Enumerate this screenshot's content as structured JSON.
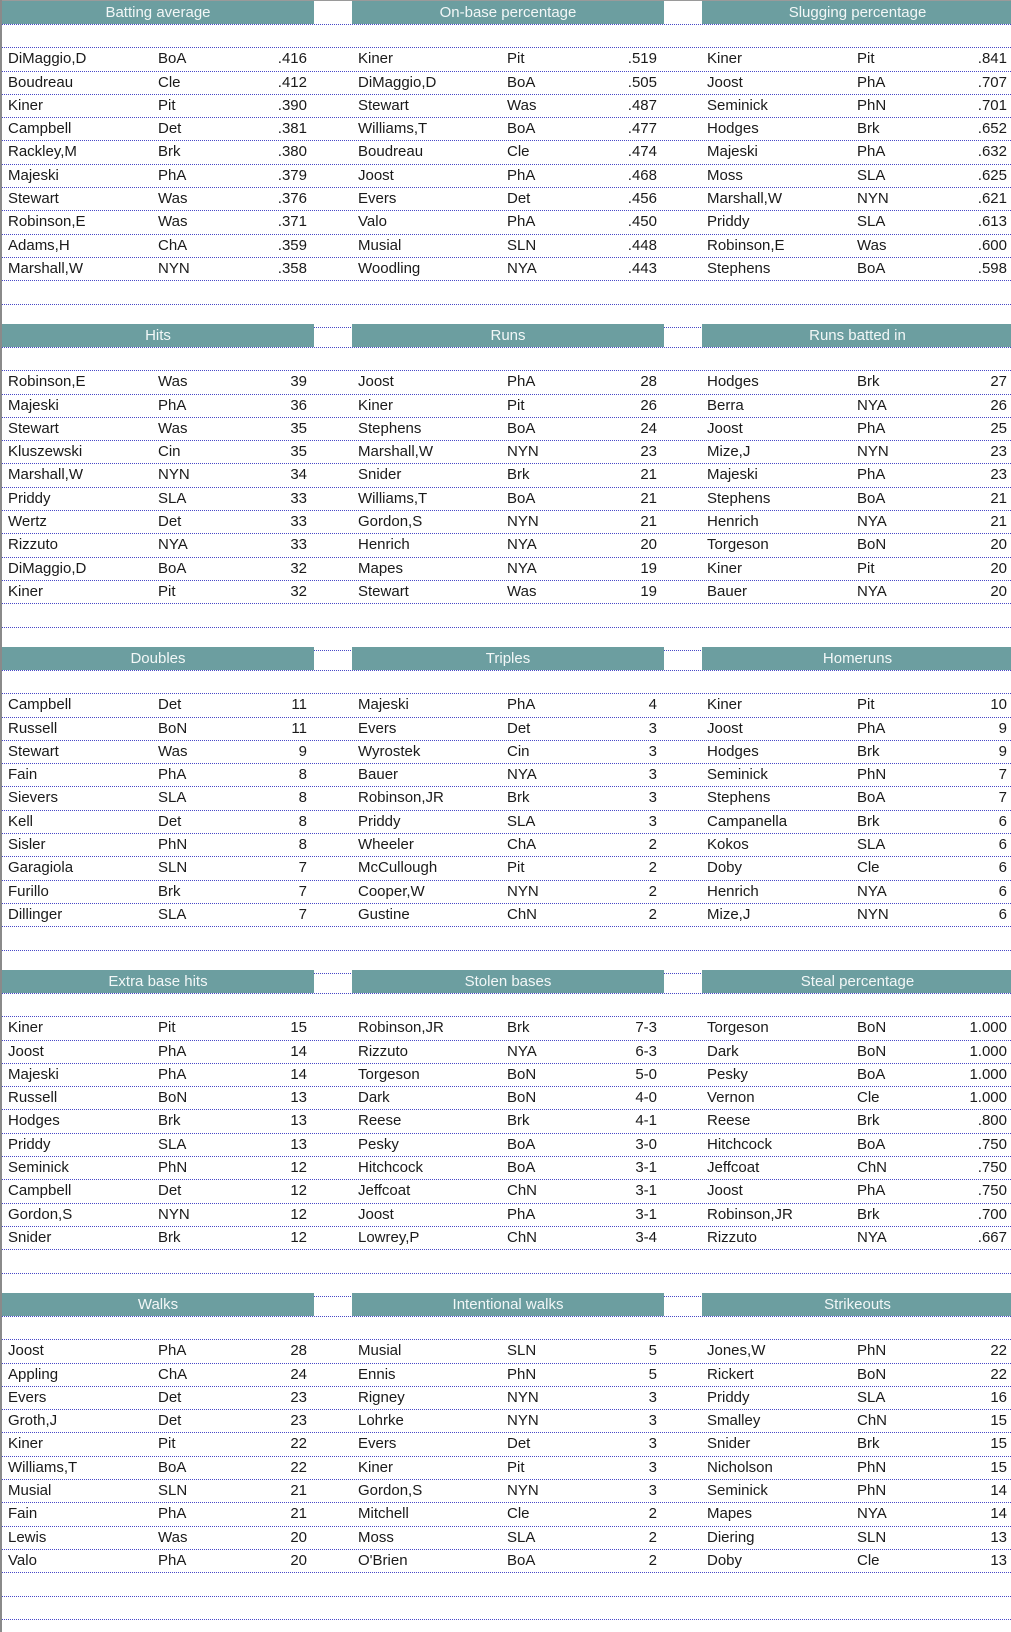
{
  "sections": [
    {
      "categories": [
        {
          "title": "Batting average",
          "rows": [
            [
              "DiMaggio,D",
              "BoA",
              ".416"
            ],
            [
              "Boudreau",
              "Cle",
              ".412"
            ],
            [
              "Kiner",
              "Pit",
              ".390"
            ],
            [
              "Campbell",
              "Det",
              ".381"
            ],
            [
              "Rackley,M",
              "Brk",
              ".380"
            ],
            [
              "Majeski",
              "PhA",
              ".379"
            ],
            [
              "Stewart",
              "Was",
              ".376"
            ],
            [
              "Robinson,E",
              "Was",
              ".371"
            ],
            [
              "Adams,H",
              "ChA",
              ".359"
            ],
            [
              "Marshall,W",
              "NYN",
              ".358"
            ]
          ]
        },
        {
          "title": "On-base percentage",
          "rows": [
            [
              "Kiner",
              "Pit",
              ".519"
            ],
            [
              "DiMaggio,D",
              "BoA",
              ".505"
            ],
            [
              "Stewart",
              "Was",
              ".487"
            ],
            [
              "Williams,T",
              "BoA",
              ".477"
            ],
            [
              "Boudreau",
              "Cle",
              ".474"
            ],
            [
              "Joost",
              "PhA",
              ".468"
            ],
            [
              "Evers",
              "Det",
              ".456"
            ],
            [
              "Valo",
              "PhA",
              ".450"
            ],
            [
              "Musial",
              "SLN",
              ".448"
            ],
            [
              "Woodling",
              "NYA",
              ".443"
            ]
          ]
        },
        {
          "title": "Slugging percentage",
          "rows": [
            [
              "Kiner",
              "Pit",
              ".841"
            ],
            [
              "Joost",
              "PhA",
              ".707"
            ],
            [
              "Seminick",
              "PhN",
              ".701"
            ],
            [
              "Hodges",
              "Brk",
              ".652"
            ],
            [
              "Majeski",
              "PhA",
              ".632"
            ],
            [
              "Moss",
              "SLA",
              ".625"
            ],
            [
              "Marshall,W",
              "NYN",
              ".621"
            ],
            [
              "Priddy",
              "SLA",
              ".613"
            ],
            [
              "Robinson,E",
              "Was",
              ".600"
            ],
            [
              "Stephens",
              "BoA",
              ".598"
            ]
          ]
        }
      ]
    },
    {
      "categories": [
        {
          "title": "Hits",
          "rows": [
            [
              "Robinson,E",
              "Was",
              "39"
            ],
            [
              "Majeski",
              "PhA",
              "36"
            ],
            [
              "Stewart",
              "Was",
              "35"
            ],
            [
              "Kluszewski",
              "Cin",
              "35"
            ],
            [
              "Marshall,W",
              "NYN",
              "34"
            ],
            [
              "Priddy",
              "SLA",
              "33"
            ],
            [
              "Wertz",
              "Det",
              "33"
            ],
            [
              "Rizzuto",
              "NYA",
              "33"
            ],
            [
              "DiMaggio,D",
              "BoA",
              "32"
            ],
            [
              "Kiner",
              "Pit",
              "32"
            ]
          ]
        },
        {
          "title": "Runs",
          "rows": [
            [
              "Joost",
              "PhA",
              "28"
            ],
            [
              "Kiner",
              "Pit",
              "26"
            ],
            [
              "Stephens",
              "BoA",
              "24"
            ],
            [
              "Marshall,W",
              "NYN",
              "23"
            ],
            [
              "Snider",
              "Brk",
              "21"
            ],
            [
              "Williams,T",
              "BoA",
              "21"
            ],
            [
              "Gordon,S",
              "NYN",
              "21"
            ],
            [
              "Henrich",
              "NYA",
              "20"
            ],
            [
              "Mapes",
              "NYA",
              "19"
            ],
            [
              "Stewart",
              "Was",
              "19"
            ]
          ]
        },
        {
          "title": "Runs batted in",
          "rows": [
            [
              "Hodges",
              "Brk",
              "27"
            ],
            [
              "Berra",
              "NYA",
              "26"
            ],
            [
              "Joost",
              "PhA",
              "25"
            ],
            [
              "Mize,J",
              "NYN",
              "23"
            ],
            [
              "Majeski",
              "PhA",
              "23"
            ],
            [
              "Stephens",
              "BoA",
              "21"
            ],
            [
              "Henrich",
              "NYA",
              "21"
            ],
            [
              "Torgeson",
              "BoN",
              "20"
            ],
            [
              "Kiner",
              "Pit",
              "20"
            ],
            [
              "Bauer",
              "NYA",
              "20"
            ]
          ]
        }
      ]
    },
    {
      "categories": [
        {
          "title": "Doubles",
          "rows": [
            [
              "Campbell",
              "Det",
              "11"
            ],
            [
              "Russell",
              "BoN",
              "11"
            ],
            [
              "Stewart",
              "Was",
              "9"
            ],
            [
              "Fain",
              "PhA",
              "8"
            ],
            [
              "Sievers",
              "SLA",
              "8"
            ],
            [
              "Kell",
              "Det",
              "8"
            ],
            [
              "Sisler",
              "PhN",
              "8"
            ],
            [
              "Garagiola",
              "SLN",
              "7"
            ],
            [
              "Furillo",
              "Brk",
              "7"
            ],
            [
              "Dillinger",
              "SLA",
              "7"
            ]
          ]
        },
        {
          "title": "Triples",
          "rows": [
            [
              "Majeski",
              "PhA",
              "4"
            ],
            [
              "Evers",
              "Det",
              "3"
            ],
            [
              "Wyrostek",
              "Cin",
              "3"
            ],
            [
              "Bauer",
              "NYA",
              "3"
            ],
            [
              "Robinson,JR",
              "Brk",
              "3"
            ],
            [
              "Priddy",
              "SLA",
              "3"
            ],
            [
              "Wheeler",
              "ChA",
              "2"
            ],
            [
              "McCullough",
              "Pit",
              "2"
            ],
            [
              "Cooper,W",
              "NYN",
              "2"
            ],
            [
              "Gustine",
              "ChN",
              "2"
            ]
          ]
        },
        {
          "title": "Homeruns",
          "rows": [
            [
              "Kiner",
              "Pit",
              "10"
            ],
            [
              "Joost",
              "PhA",
              "9"
            ],
            [
              "Hodges",
              "Brk",
              "9"
            ],
            [
              "Seminick",
              "PhN",
              "7"
            ],
            [
              "Stephens",
              "BoA",
              "7"
            ],
            [
              "Campanella",
              "Brk",
              "6"
            ],
            [
              "Kokos",
              "SLA",
              "6"
            ],
            [
              "Doby",
              "Cle",
              "6"
            ],
            [
              "Henrich",
              "NYA",
              "6"
            ],
            [
              "Mize,J",
              "NYN",
              "6"
            ]
          ]
        }
      ]
    },
    {
      "categories": [
        {
          "title": "Extra base hits",
          "rows": [
            [
              "Kiner",
              "Pit",
              "15"
            ],
            [
              "Joost",
              "PhA",
              "14"
            ],
            [
              "Majeski",
              "PhA",
              "14"
            ],
            [
              "Russell",
              "BoN",
              "13"
            ],
            [
              "Hodges",
              "Brk",
              "13"
            ],
            [
              "Priddy",
              "SLA",
              "13"
            ],
            [
              "Seminick",
              "PhN",
              "12"
            ],
            [
              "Campbell",
              "Det",
              "12"
            ],
            [
              "Gordon,S",
              "NYN",
              "12"
            ],
            [
              "Snider",
              "Brk",
              "12"
            ]
          ]
        },
        {
          "title": "Stolen bases",
          "rows": [
            [
              "Robinson,JR",
              "Brk",
              "7-3"
            ],
            [
              "Rizzuto",
              "NYA",
              "6-3"
            ],
            [
              "Torgeson",
              "BoN",
              "5-0"
            ],
            [
              "Dark",
              "BoN",
              "4-0"
            ],
            [
              "Reese",
              "Brk",
              "4-1"
            ],
            [
              "Pesky",
              "BoA",
              "3-0"
            ],
            [
              "Hitchcock",
              "BoA",
              "3-1"
            ],
            [
              "Jeffcoat",
              "ChN",
              "3-1"
            ],
            [
              "Joost",
              "PhA",
              "3-1"
            ],
            [
              "Lowrey,P",
              "ChN",
              "3-4"
            ]
          ]
        },
        {
          "title": "Steal percentage",
          "rows": [
            [
              "Torgeson",
              "BoN",
              "1.000"
            ],
            [
              "Dark",
              "BoN",
              "1.000"
            ],
            [
              "Pesky",
              "BoA",
              "1.000"
            ],
            [
              "Vernon",
              "Cle",
              "1.000"
            ],
            [
              "Reese",
              "Brk",
              ".800"
            ],
            [
              "Hitchcock",
              "BoA",
              ".750"
            ],
            [
              "Jeffcoat",
              "ChN",
              ".750"
            ],
            [
              "Joost",
              "PhA",
              ".750"
            ],
            [
              "Robinson,JR",
              "Brk",
              ".700"
            ],
            [
              "Rizzuto",
              "NYA",
              ".667"
            ]
          ]
        }
      ]
    },
    {
      "categories": [
        {
          "title": "Walks",
          "rows": [
            [
              "Joost",
              "PhA",
              "28"
            ],
            [
              "Appling",
              "ChA",
              "24"
            ],
            [
              "Evers",
              "Det",
              "23"
            ],
            [
              "Groth,J",
              "Det",
              "23"
            ],
            [
              "Kiner",
              "Pit",
              "22"
            ],
            [
              "Williams,T",
              "BoA",
              "22"
            ],
            [
              "Musial",
              "SLN",
              "21"
            ],
            [
              "Fain",
              "PhA",
              "21"
            ],
            [
              "Lewis",
              "Was",
              "20"
            ],
            [
              "Valo",
              "PhA",
              "20"
            ]
          ]
        },
        {
          "title": "Intentional walks",
          "rows": [
            [
              "Musial",
              "SLN",
              "5"
            ],
            [
              "Ennis",
              "PhN",
              "5"
            ],
            [
              "Rigney",
              "NYN",
              "3"
            ],
            [
              "Lohrke",
              "NYN",
              "3"
            ],
            [
              "Evers",
              "Det",
              "3"
            ],
            [
              "Kiner",
              "Pit",
              "3"
            ],
            [
              "Gordon,S",
              "NYN",
              "3"
            ],
            [
              "Mitchell",
              "Cle",
              "2"
            ],
            [
              "Moss",
              "SLA",
              "2"
            ],
            [
              "O'Brien",
              "BoA",
              "2"
            ]
          ]
        },
        {
          "title": "Strikeouts",
          "rows": [
            [
              "Jones,W",
              "PhN",
              "22"
            ],
            [
              "Rickert",
              "BoN",
              "22"
            ],
            [
              "Priddy",
              "SLA",
              "16"
            ],
            [
              "Smalley",
              "ChN",
              "15"
            ],
            [
              "Snider",
              "Brk",
              "15"
            ],
            [
              "Nicholson",
              "PhN",
              "15"
            ],
            [
              "Seminick",
              "PhN",
              "14"
            ],
            [
              "Mapes",
              "NYA",
              "14"
            ],
            [
              "Diering",
              "SLN",
              "13"
            ],
            [
              "Doby",
              "Cle",
              "13"
            ]
          ]
        }
      ]
    }
  ]
}
